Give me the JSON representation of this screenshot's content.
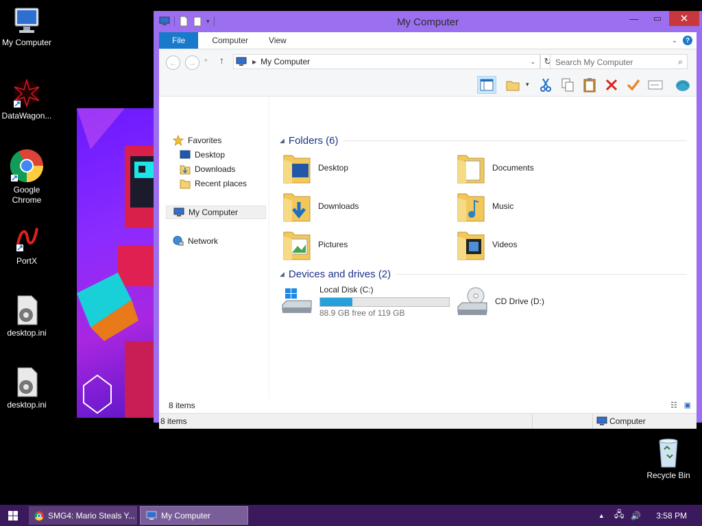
{
  "desktop": {
    "icons": [
      {
        "label": "My Computer"
      },
      {
        "label": "DataWagon..."
      },
      {
        "label": "Google Chrome"
      },
      {
        "label": "PortX"
      },
      {
        "label": "desktop.ini"
      },
      {
        "label": "desktop.ini"
      },
      {
        "label": "Recycle Bin"
      }
    ]
  },
  "window": {
    "title": "My Computer",
    "tabs": [
      "File",
      "Computer",
      "View"
    ],
    "address": "My Computer",
    "search_placeholder": "Search My Computer",
    "help_label": "?",
    "nav": {
      "favorites": "Favorites",
      "desktop": "Desktop",
      "downloads": "Downloads",
      "recent": "Recent places",
      "computer": "My Computer",
      "network": "Network"
    },
    "folders_header": "Folders (6)",
    "folders": [
      "Desktop",
      "Documents",
      "Downloads",
      "Music",
      "Pictures",
      "Videos"
    ],
    "drives_header": "Devices and drives (2)",
    "drives": [
      {
        "name": "Local Disk (C:)",
        "free_text": "88.9 GB free of 119 GB",
        "used_fraction": 0.25
      },
      {
        "name": "CD Drive (D:)"
      }
    ],
    "status_items": "8 items",
    "status_items_bottom": "8 items",
    "status_location": "Computer"
  },
  "taskbar": {
    "tasks": [
      {
        "label": "SMG4: Mario Steals Y..."
      },
      {
        "label": "My Computer"
      }
    ],
    "clock": "3:58 PM"
  },
  "colors": {
    "window_frame": "#9c6ff0",
    "accent": "#1979ca",
    "close": "#c7383c",
    "taskbar": "#3a1a5c"
  }
}
